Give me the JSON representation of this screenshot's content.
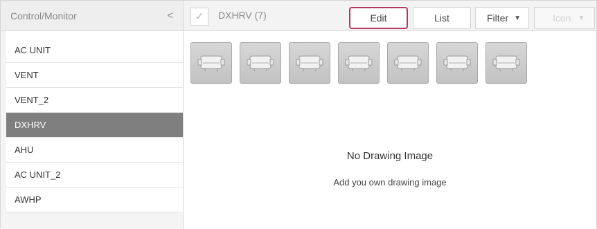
{
  "left_panel": {
    "title": "Control/Monitor",
    "collapse_glyph": "<",
    "items": [
      {
        "label": "AC UNIT"
      },
      {
        "label": "VENT"
      },
      {
        "label": "VENT_2"
      },
      {
        "label": "DXHRV"
      },
      {
        "label": "AHU"
      },
      {
        "label": "AC UNIT_2"
      },
      {
        "label": "AWHP"
      }
    ],
    "selected_label": "DXHRV"
  },
  "toolbar": {
    "check_glyph": "✓",
    "group_title": "DXHRV (7)",
    "edit_label": "Edit",
    "list_label": "List",
    "filter_label": "Filter",
    "icon_label": "Icon",
    "dropdown_glyph": "▼"
  },
  "devices": [
    {
      "icon": "dxhrv-unit-icon"
    },
    {
      "icon": "dxhrv-unit-icon"
    },
    {
      "icon": "dxhrv-unit-icon"
    },
    {
      "icon": "dxhrv-unit-icon"
    },
    {
      "icon": "dxhrv-unit-icon"
    },
    {
      "icon": "dxhrv-unit-icon"
    },
    {
      "icon": "dxhrv-unit-icon"
    }
  ],
  "empty_state": {
    "title": "No Drawing Image",
    "subtitle": "Add you own drawing image"
  },
  "colors": {
    "selected_bg": "#7f7f7f",
    "edit_highlight": "#b23a5e"
  }
}
